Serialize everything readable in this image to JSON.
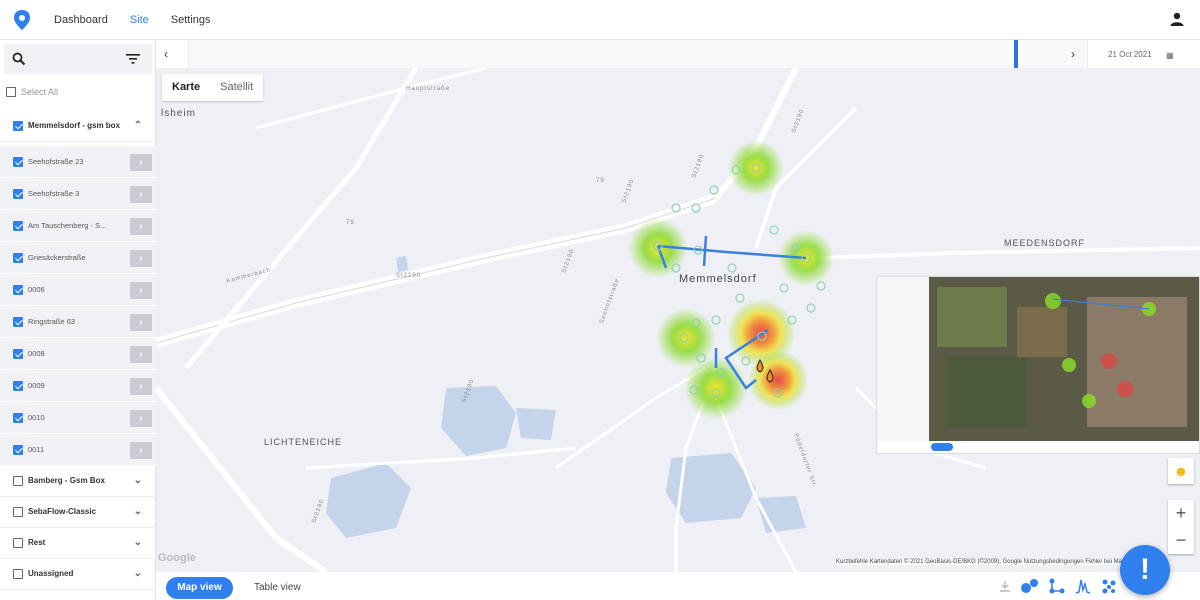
{
  "nav": {
    "dashboard": "Dashboard",
    "site": "Site",
    "settings": "Settings"
  },
  "sidebar": {
    "select_all": "Select All",
    "groups": [
      {
        "label": "Memmelsdorf - gsm box",
        "checked": true,
        "expanded": true
      },
      {
        "label": "Bamberg - Gsm Box",
        "checked": false,
        "expanded": false
      },
      {
        "label": "SebaFlow-Classic",
        "checked": false,
        "expanded": false
      },
      {
        "label": "Rest",
        "checked": false,
        "expanded": false
      },
      {
        "label": "Unassigned",
        "checked": false,
        "expanded": false
      }
    ],
    "sites": [
      "Seehofstraße 23",
      "Seehofstraße 3",
      "Am Tauschenberg - S...",
      "Griesäckerstraße",
      "0006",
      "Ringstraße 63",
      "0008",
      "0009",
      "0010",
      "0011"
    ]
  },
  "timeline": {
    "date": "21 Oct 2021"
  },
  "map": {
    "type_karte": "Karte",
    "type_satellit": "Satellit",
    "labels": {
      "memmelsdorf": "Memmelsdorf",
      "meedensdorf": "MEEDENSDORF",
      "lichteneiche": "LICHTENEICHE",
      "lsheim": "lsheim",
      "hauptstrasse": "Hauptstraße",
      "st2190a": "St2190",
      "st2190b": "St2190",
      "st2190c": "St2190",
      "st2190d": "St2190",
      "st2190e": "St2190",
      "st2190f": "St2190",
      "st2190g": "St2190",
      "seehofstr": "Seehofstraße",
      "pödeldorfer": "Pödeldorfer Str.",
      "kammerbach": "Kammerbach",
      "n79a": "79",
      "n79b": "79"
    },
    "google": "Google",
    "attribution": "Kurzbefehle    Kartendaten © 2021 GeoBasis-DE/BKG (©2009), Google    Nutzungsbedingungen    Fehler bei Maps melden"
  },
  "bottom": {
    "map_view": "Map view",
    "table_view": "Table view"
  },
  "fab_label": "!",
  "colors": {
    "accent": "#2f80ed",
    "heat_low": "#7cdb2c",
    "heat_mid": "#f5e51b",
    "heat_high": "#e8443a"
  }
}
